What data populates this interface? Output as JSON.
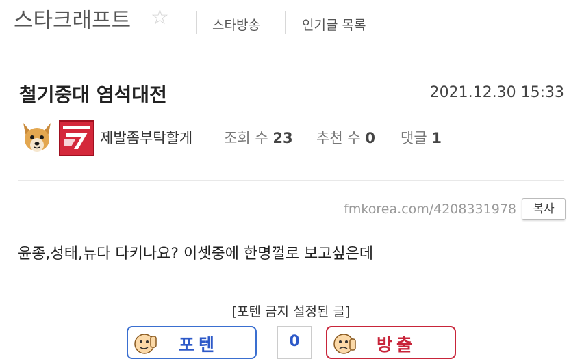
{
  "header": {
    "board_title": "스타크래프트",
    "nav": [
      "스타방송",
      "인기글 목록"
    ]
  },
  "post": {
    "title": "철기중대 염석대전",
    "date": "2021.12.30 15:33",
    "author": "제발좀부탁할게",
    "stats": {
      "views_label": "조회 수",
      "views": "23",
      "recommend_label": "추천 수",
      "recommend": "0",
      "comments_label": "댓글",
      "comments": "1"
    },
    "url": "fmkorea.com/4208331978",
    "copy_label": "복사",
    "content": "윤종,성태,뉴다 다키나요? 이셋중에 한명껄로 보고싶은데",
    "notice": "[포텐 금지 설정된 글]"
  },
  "vote": {
    "up_label": "포텐",
    "count": "0",
    "down_label": "방출"
  },
  "colors": {
    "vote_up": "#2d59c8",
    "vote_down": "#c8253a",
    "badge_red": "#d4283b"
  },
  "icons": {
    "favorite": "star-outline-icon",
    "avatar": "dog-face-avatar",
    "badge": "red-team-emblem"
  }
}
